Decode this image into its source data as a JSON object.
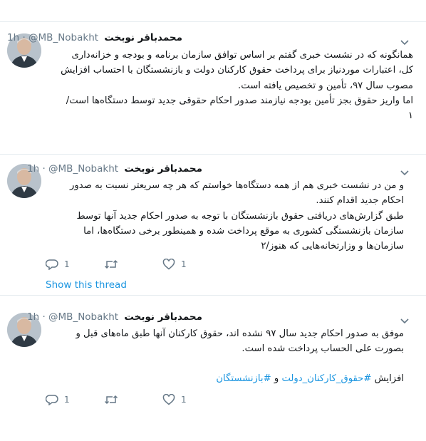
{
  "tweets": [
    {
      "display_name": "محمدباقر نوبخت",
      "handle": "@MB_Nobakht",
      "separator": "·",
      "time": "1h",
      "text_lines": [
        "همانگونه که در نشست خبری گفتم بر اساس توافق سازمان برنامه و بودجه و خزانه‌داری",
        "کل، اعتبارات موردنیاز برای پرداخت حقوق کارکنان دولت و بازنشستگان با احتساب افزایش",
        "مصوب سال ۹۷، تأمین و تخصیص یافته است.",
        "اما واریز حقوق بجز تأمین بودجه نیازمند صدور احکام حقوقی جدید توسط دستگاه‌ها است/",
        "۱"
      ]
    },
    {
      "display_name": "محمدباقر نوبخت",
      "handle": "@MB_Nobakht",
      "separator": "·",
      "time": "1h",
      "text_lines": [
        "و من در نشست خبری هم از همه دستگاه‌ها خواستم که هر چه سریعتر نسبت به صدور",
        "احکام جدید اقدام کنند.",
        "طبق گزارش‌های دریافتی حقوق بازنشستگان با توجه به صدور احکام جدید آنها توسط",
        "سازمان بازنشستگی کشوری به موقع پرداخت شده و همینطور برخی دستگاه‌ها، اما",
        "سازمان‌ها و وزارتخانه‌هایی که هنوز/۲"
      ],
      "reply_count": "1",
      "like_count": "1",
      "show_thread": "Show this thread"
    },
    {
      "display_name": "محمدباقر نوبخت",
      "handle": "@MB_Nobakht",
      "separator": "·",
      "time": "1h",
      "text_lines": [
        "موفق به صدور احکام جدید سال ۹۷ نشده اند، حقوق کارکنان آنها طبق ماه‌های قبل و",
        "بصورت علی الحساب پرداخت شده است."
      ],
      "tag_prefix": "افزایش",
      "tag1": "#حقوق_کارکنان_دولت",
      "tag_join": "و",
      "tag2": "#بازنشستگان",
      "reply_count": "1",
      "like_count": "1"
    }
  ],
  "icons": {
    "reply": "reply-icon",
    "retweet": "retweet-icon",
    "like": "heart-icon",
    "caret": "chevron-down-icon"
  },
  "colors": {
    "link": "#1b95e0",
    "muted": "#657786",
    "divider": "#e6ecf0"
  }
}
